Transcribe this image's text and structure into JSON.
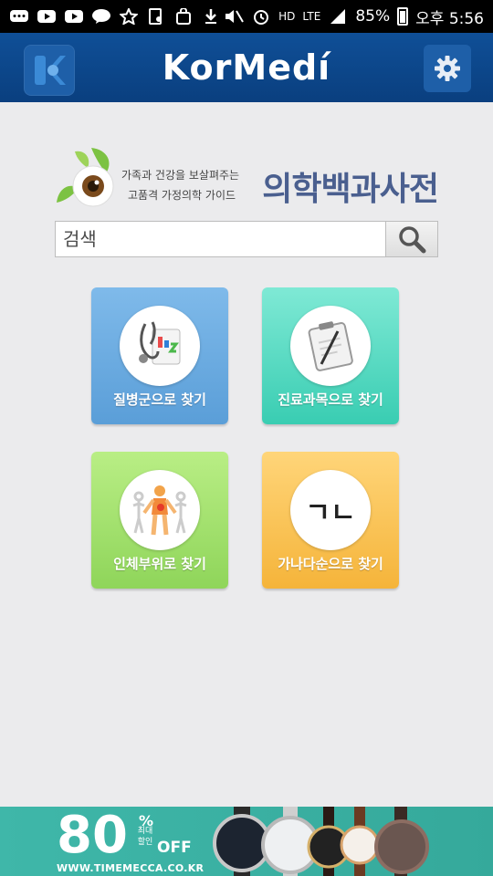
{
  "status_bar": {
    "lte": "LTE",
    "battery": "85%",
    "time": "오후 5:56",
    "hd": "HD"
  },
  "header": {
    "logo": "KorMedí"
  },
  "brand": {
    "tagline_1": "가족과 건강을 보살펴주는",
    "tagline_2": "고품격 가정의학 가이드",
    "title": "의학백과사전"
  },
  "search": {
    "placeholder": "검색"
  },
  "tiles": [
    {
      "label": "질병군으로 찾기"
    },
    {
      "label": "진료과목으로 찾기"
    },
    {
      "label": "인체부위로 찾기"
    },
    {
      "label": "가나다순으로 찾기"
    }
  ],
  "tile_icon_text": "ㄱㄴ",
  "ad": {
    "big": "80",
    "percent": "%",
    "max_label": "최대 할인",
    "off": "OFF",
    "url": "WWW.TIMEMECCA.CO.KR"
  },
  "colors": {
    "header": "#0f4f97",
    "tile_blue": "#5a9ed8",
    "tile_teal": "#39cdb2",
    "tile_green": "#8fd55a",
    "tile_orange": "#f5b43a",
    "ad": "#3fb7a9"
  }
}
